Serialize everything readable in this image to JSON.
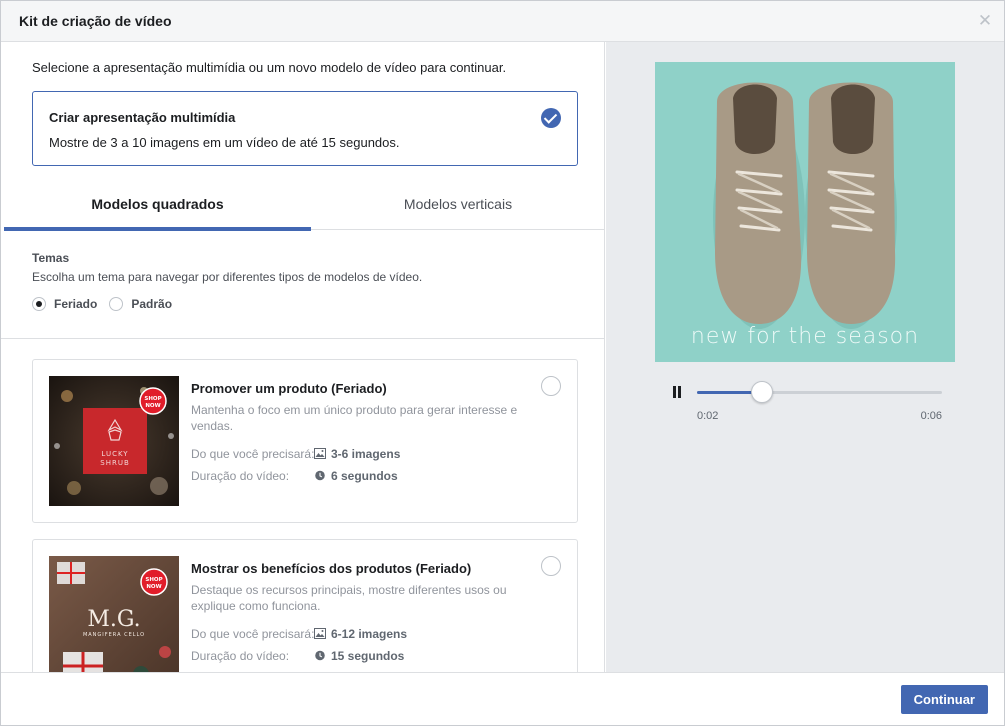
{
  "dialog": {
    "title": "Kit de criação de vídeo",
    "close_icon": "close-icon"
  },
  "left": {
    "intro": "Selecione a apresentação multimídia ou um novo modelo de vídeo para continuar.",
    "slideshow_card": {
      "title": "Criar apresentação multimídia",
      "description": "Mostre de 3 a 10 imagens em um vídeo de até 15 segundos.",
      "selected": true
    },
    "tabs": [
      {
        "label": "Modelos quadrados",
        "active": true
      },
      {
        "label": "Modelos verticais",
        "active": false
      }
    ],
    "themes": {
      "label": "Temas",
      "description": "Escolha um tema para navegar por diferentes tipos de modelos de vídeo.",
      "options": [
        {
          "label": "Feriado",
          "selected": true
        },
        {
          "label": "Padrão",
          "selected": false
        }
      ]
    },
    "templates": [
      {
        "title": "Promover um produto (Feriado)",
        "description": "Mantenha o foco em um único produto para gerar interesse e vendas.",
        "need_label": "Do que você precisará:",
        "need_value": "3-6 imagens",
        "duration_label": "Duração do vídeo:",
        "duration_value": "6 segundos",
        "thumb_text": "LUCKY SHRUB",
        "badge_text": "SHOP NOW"
      },
      {
        "title": "Mostrar os benefícios dos produtos (Feriado)",
        "description": "Destaque os recursos principais, mostre diferentes usos ou explique como funciona.",
        "need_label": "Do que você precisará:",
        "need_value": "6-12 imagens",
        "duration_label": "Duração do vídeo:",
        "duration_value": "15 segundos",
        "thumb_text": "M.G.",
        "thumb_subtext": "MANGIFERA CELLO",
        "badge_text": "SHOP NOW"
      }
    ]
  },
  "preview": {
    "caption": "new for the season",
    "current_time": "0:02",
    "total_time": "0:06",
    "progress": 0.265
  },
  "footer": {
    "continue_label": "Continuar"
  },
  "colors": {
    "accent": "#4267b2",
    "preview_bg": "#8fd1c8"
  }
}
